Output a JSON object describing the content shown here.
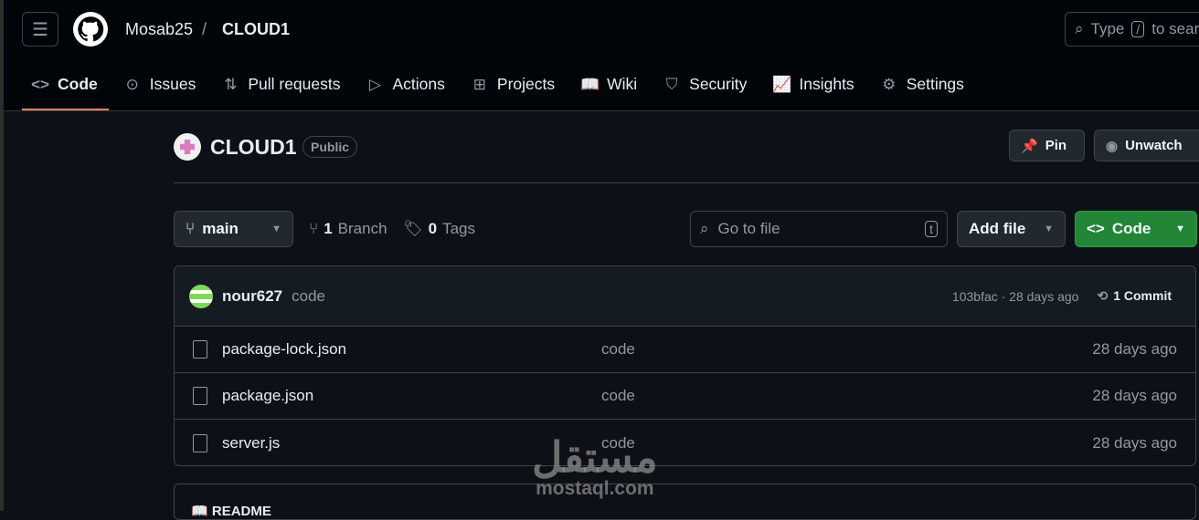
{
  "header": {
    "owner": "Mosab25",
    "separator": "/",
    "repo": "CLOUD1",
    "search_prefix": "Type",
    "search_key": "/",
    "search_suffix": "to search"
  },
  "nav": [
    {
      "label": "Code",
      "icon": "<>"
    },
    {
      "label": "Issues",
      "icon": "⊙"
    },
    {
      "label": "Pull requests",
      "icon": "⇅"
    },
    {
      "label": "Actions",
      "icon": "▷"
    },
    {
      "label": "Projects",
      "icon": "⊞"
    },
    {
      "label": "Wiki",
      "icon": "📖"
    },
    {
      "label": "Security",
      "icon": "⛉"
    },
    {
      "label": "Insights",
      "icon": "📈"
    },
    {
      "label": "Settings",
      "icon": "⚙"
    }
  ],
  "repo": {
    "name": "CLOUD1",
    "visibility": "Public",
    "pin": "Pin",
    "unwatch": "Unwatch"
  },
  "toolbar": {
    "branch": "main",
    "branches_count": "1",
    "branches_label": "Branch",
    "tags_count": "0",
    "tags_label": "Tags",
    "goto_placeholder": "Go to file",
    "goto_key": "t",
    "add_file": "Add file",
    "code": "Code"
  },
  "commit": {
    "author": "nour627",
    "message": "code",
    "sha_time": "103bfac · 28 days ago",
    "commits": "1 Commit"
  },
  "files": [
    {
      "name": "package-lock.json",
      "message": "code",
      "time": "28 days ago"
    },
    {
      "name": "package.json",
      "message": "code",
      "time": "28 days ago"
    },
    {
      "name": "server.js",
      "message": "code",
      "time": "28 days ago"
    }
  ],
  "readme": "README",
  "watermark": {
    "arabic": "مستقل",
    "latin": "mostaql.com"
  }
}
